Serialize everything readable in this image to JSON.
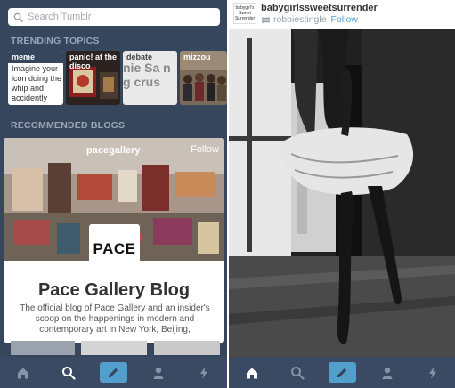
{
  "left": {
    "search": {
      "placeholder": "Search Tumblr",
      "icon": "search-icon"
    },
    "trending": {
      "title": "TRENDING TOPICS",
      "cards": [
        {
          "tag": "meme",
          "text": "Imagine your icon doing the whip and accidently"
        },
        {
          "tag": "panic! at the disco"
        },
        {
          "tag": "debate",
          "overlay_text": "nie Sa ng crus"
        },
        {
          "tag": "mizzou"
        }
      ]
    },
    "recommended": {
      "title": "RECOMMENDED BLOGS",
      "blog": {
        "name": "pacegallery",
        "follow": "Follow",
        "logo_text": "PACE",
        "title": "Pace Gallery Blog",
        "description": "The official blog of Pace Gallery and an insider's scoop on the happenings in modern and contemporary art in New York, Beijing,"
      }
    },
    "tabbar": {
      "items": [
        "home-icon",
        "search-icon",
        "compose-icon",
        "account-icon",
        "activity-icon"
      ],
      "active": "search-icon"
    }
  },
  "right": {
    "post": {
      "blog_name": "babygirlssweetsurrender",
      "avatar_text": "babygirl's Sweet Surrender",
      "reblogged_from": "robbiestingle",
      "follow": "Follow"
    },
    "tabbar": {
      "items": [
        "home-icon",
        "search-icon",
        "compose-icon",
        "account-icon",
        "activity-icon"
      ],
      "active": "home-icon"
    }
  },
  "colors": {
    "tumblr_navy": "#36465d",
    "tab_bar": "#3a4a63",
    "accent_blue": "#529ecc"
  }
}
